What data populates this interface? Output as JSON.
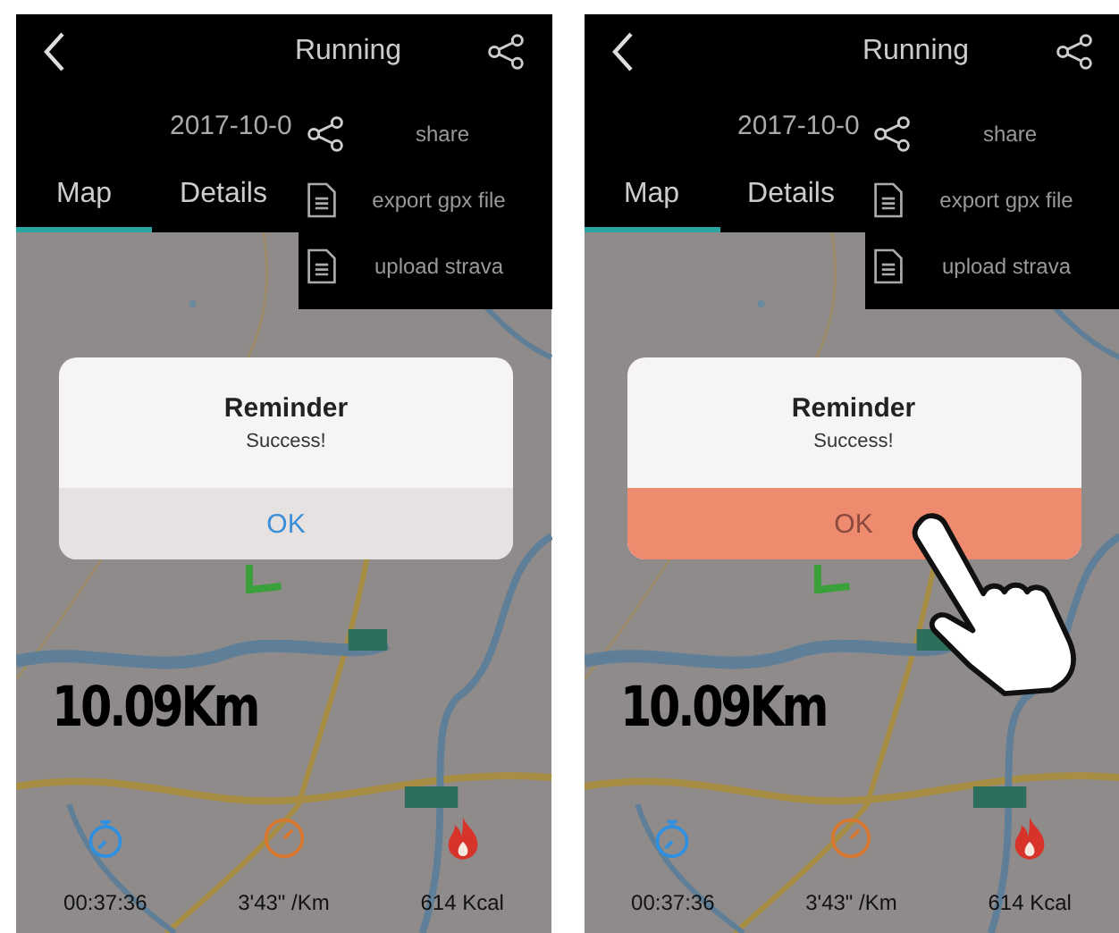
{
  "screens": [
    {
      "title": "Running",
      "date": "2017-10-0",
      "tabs": [
        {
          "label": "Map",
          "selected": true
        },
        {
          "label": "Details",
          "selected": false
        }
      ],
      "menu": [
        {
          "label": "share",
          "kind": "share"
        },
        {
          "label": "export gpx file",
          "kind": "document"
        },
        {
          "label": "upload strava",
          "kind": "document"
        }
      ],
      "dialog": {
        "title": "Reminder",
        "message": "Success!",
        "button": {
          "label": "OK",
          "pressed": false
        }
      },
      "distance": "10.09Km",
      "stats": [
        {
          "kind": "time",
          "value": "00:37:36"
        },
        {
          "kind": "pace",
          "value": "3'43\" /Km"
        },
        {
          "kind": "calories",
          "value": "614 Kcal"
        }
      ]
    },
    {
      "title": "Running",
      "date": "2017-10-0",
      "tabs": [
        {
          "label": "Map",
          "selected": true
        },
        {
          "label": "Details",
          "selected": false
        }
      ],
      "menu": [
        {
          "label": "share",
          "kind": "share"
        },
        {
          "label": "export gpx file",
          "kind": "document"
        },
        {
          "label": "upload strava",
          "kind": "document"
        }
      ],
      "dialog": {
        "title": "Reminder",
        "message": "Success!",
        "button": {
          "label": "OK",
          "pressed": true
        }
      },
      "distance": "10.09Km",
      "stats": [
        {
          "kind": "time",
          "value": "00:37:36"
        },
        {
          "kind": "pace",
          "value": "3'43\" /Km"
        },
        {
          "kind": "calories",
          "value": "614 Kcal"
        }
      ]
    }
  ]
}
